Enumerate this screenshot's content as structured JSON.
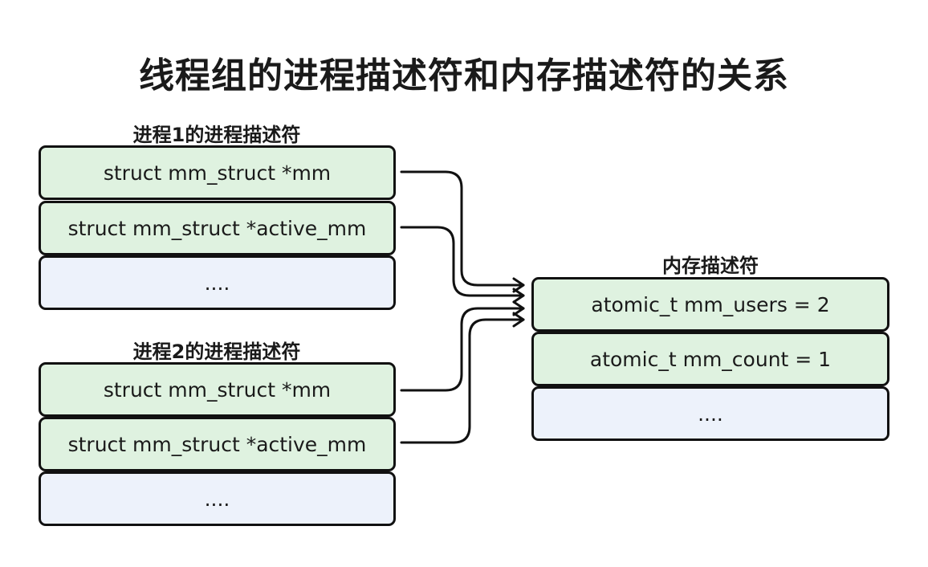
{
  "title": "线程组的进程描述符和内存描述符的关系",
  "process1": {
    "label": "进程1的进程描述符",
    "fields": [
      "struct mm_struct *mm",
      "struct mm_struct *active_mm",
      "...."
    ]
  },
  "process2": {
    "label": "进程2的进程描述符",
    "fields": [
      "struct mm_struct *mm",
      "struct mm_struct *active_mm",
      "...."
    ]
  },
  "memory": {
    "label": "内存描述符",
    "fields": [
      "atomic_t mm_users = 2",
      "atomic_t mm_count = 1",
      "...."
    ]
  },
  "colors": {
    "field_green": "#dff2e0",
    "field_blue": "#edf2fb",
    "border": "#111111"
  }
}
